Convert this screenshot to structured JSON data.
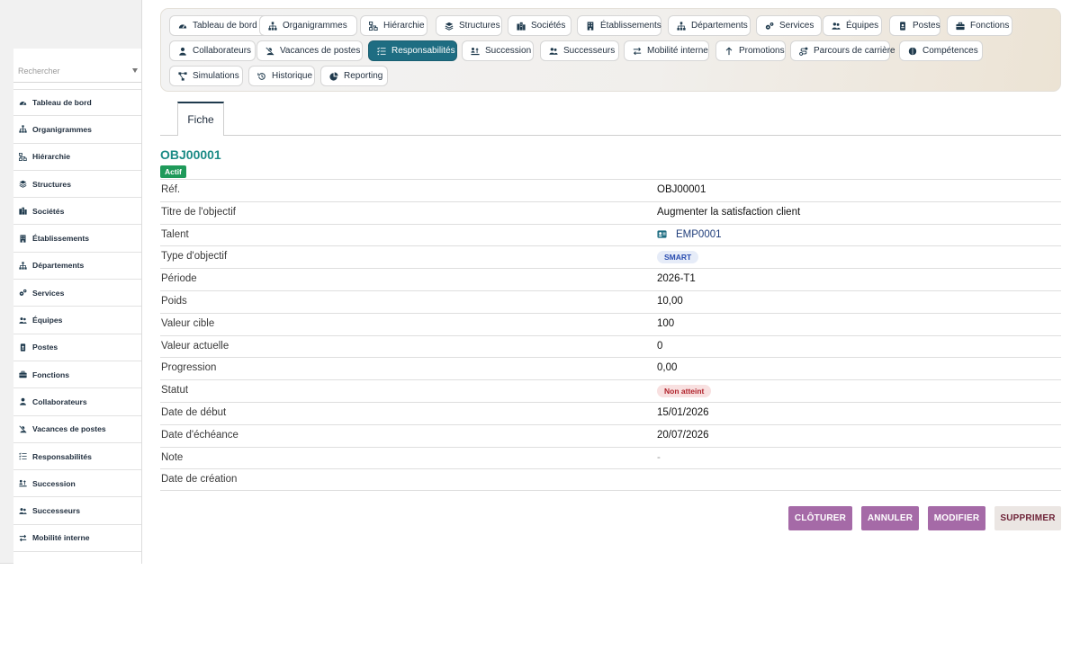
{
  "sidebar": {
    "search_placeholder": "Rechercher",
    "items": [
      {
        "label": "Tableau de bord",
        "icon": "gauge-icon"
      },
      {
        "label": "Organigrammes",
        "icon": "sitemap-icon"
      },
      {
        "label": "Hiérarchie",
        "icon": "hierarchy-icon"
      },
      {
        "label": "Structures",
        "icon": "layers-icon"
      },
      {
        "label": "Sociétés",
        "icon": "building-icon"
      },
      {
        "label": "Établissements",
        "icon": "office-icon"
      },
      {
        "label": "Départements",
        "icon": "sitemap-icon"
      },
      {
        "label": "Services",
        "icon": "cogs-icon"
      },
      {
        "label": "Équipes",
        "icon": "users-icon"
      },
      {
        "label": "Postes",
        "icon": "id-badge-icon"
      },
      {
        "label": "Fonctions",
        "icon": "briefcase-icon"
      },
      {
        "label": "Collaborateurs",
        "icon": "user-icon"
      },
      {
        "label": "Vacances de postes",
        "icon": "user-slash-icon"
      },
      {
        "label": "Responsabilités",
        "icon": "list-check-icon"
      },
      {
        "label": "Succession",
        "icon": "succession-icon"
      },
      {
        "label": "Successeurs",
        "icon": "users-icon"
      },
      {
        "label": "Mobilité interne",
        "icon": "arrows-icon"
      }
    ]
  },
  "nav": {
    "items": [
      {
        "label": "Tableau de bord",
        "icon": "gauge-icon"
      },
      {
        "label": "Organigrammes",
        "icon": "sitemap-icon"
      },
      {
        "label": "Hiérarchie",
        "icon": "hierarchy-icon"
      },
      {
        "label": "Structures",
        "icon": "layers-icon"
      },
      {
        "label": "Sociétés",
        "icon": "building-icon"
      },
      {
        "label": "Établissements",
        "icon": "office-icon"
      },
      {
        "label": "Départements",
        "icon": "sitemap-icon"
      },
      {
        "label": "Services",
        "icon": "cogs-icon"
      },
      {
        "label": "Équipes",
        "icon": "users-icon"
      },
      {
        "label": "Postes",
        "icon": "id-badge-icon"
      },
      {
        "label": "Fonctions",
        "icon": "briefcase-icon"
      },
      {
        "label": "Collaborateurs",
        "icon": "user-icon"
      },
      {
        "label": "Vacances de postes",
        "icon": "user-slash-icon"
      },
      {
        "label": "Responsabilités",
        "icon": "list-check-icon",
        "active": true
      },
      {
        "label": "Succession",
        "icon": "succession-icon"
      },
      {
        "label": "Successeurs",
        "icon": "users-icon"
      },
      {
        "label": "Mobilité interne",
        "icon": "arrows-icon"
      },
      {
        "label": "Promotions",
        "icon": "arrow-up-icon"
      },
      {
        "label": "Parcours de carrière",
        "icon": "route-icon"
      },
      {
        "label": "Compétences",
        "icon": "brain-icon"
      },
      {
        "label": "Simulations",
        "icon": "diagram-icon"
      },
      {
        "label": "Historique",
        "icon": "history-icon"
      },
      {
        "label": "Reporting",
        "icon": "pie-icon"
      }
    ]
  },
  "tab": {
    "label": "Fiche"
  },
  "record": {
    "title": "OBJ00001",
    "status": "Actif",
    "fields": {
      "ref": {
        "label": "Réf.",
        "value": "OBJ00001"
      },
      "titre": {
        "label": "Titre de l'objectif",
        "value": "Augmenter la satisfaction client"
      },
      "talent": {
        "label": "Talent",
        "value": "EMP0001"
      },
      "type": {
        "label": "Type d'objectif",
        "value": "SMART"
      },
      "periode": {
        "label": "Période",
        "value": "2026-T1"
      },
      "poids": {
        "label": "Poids",
        "value": "10,00"
      },
      "cible": {
        "label": "Valeur cible",
        "value": "100"
      },
      "actuelle": {
        "label": "Valeur actuelle",
        "value": "0"
      },
      "progression": {
        "label": "Progression",
        "value": "0,00"
      },
      "statut": {
        "label": "Statut",
        "value": "Non atteint"
      },
      "debut": {
        "label": "Date de début",
        "value": "15/01/2026"
      },
      "echeance": {
        "label": "Date d'échéance",
        "value": "20/07/2026"
      },
      "note": {
        "label": "Note",
        "value": "-"
      },
      "creation": {
        "label": "Date de création",
        "value": ""
      }
    }
  },
  "actions": {
    "cloturer": "CLÔTURER",
    "annuler": "ANNULER",
    "modifier": "MODIFIER",
    "supprimer": "SUPPRIMER"
  },
  "colors": {
    "accent": "#1e6d82",
    "title": "#1c8b86",
    "active_badge": "#1f9a5a",
    "action_purple": "#a56aa7",
    "danger_text": "#6e2438"
  }
}
